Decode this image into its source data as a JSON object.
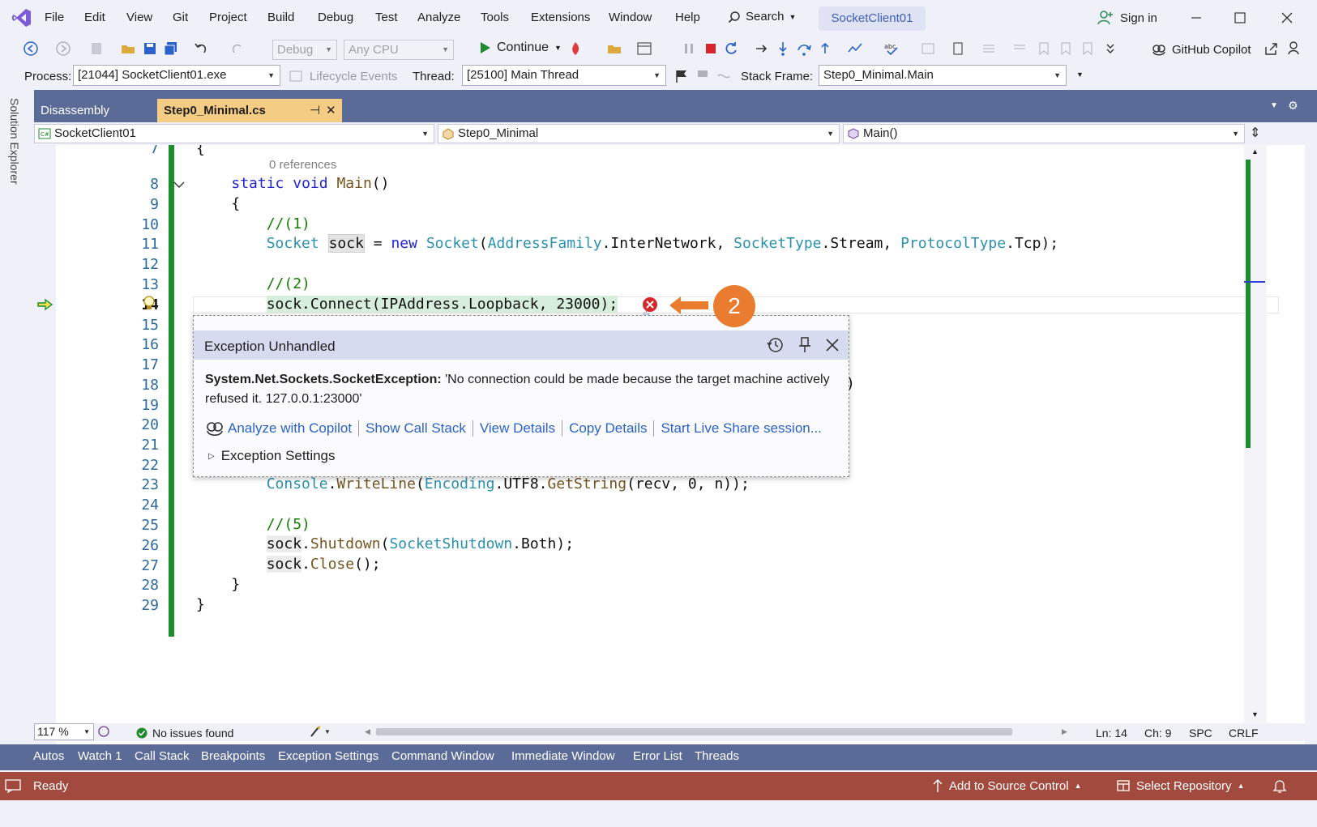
{
  "menu": {
    "items": [
      "File",
      "Edit",
      "View",
      "Git",
      "Project",
      "Build",
      "Debug",
      "Test",
      "Analyze",
      "Tools",
      "Extensions",
      "Window",
      "Help"
    ],
    "search_label": "Search",
    "solution_name": "SocketClient01",
    "sign_in": "Sign in"
  },
  "toolbar": {
    "configuration": "Debug",
    "platform": "Any CPU",
    "continue_label": "Continue",
    "copilot_label": "GitHub Copilot"
  },
  "debug_location": {
    "process_label": "Process:",
    "process_value": "[21044] SocketClient01.exe",
    "lifecycle_label": "Lifecycle Events",
    "thread_label": "Thread:",
    "thread_value": "[25100] Main Thread",
    "stack_frame_label": "Stack Frame:",
    "stack_frame_value": "Step0_Minimal.Main"
  },
  "left_rail": {
    "label": "Solution Explorer"
  },
  "doc_tabs": [
    {
      "label": "Disassembly"
    },
    {
      "label": "Step0_Minimal.cs"
    }
  ],
  "navbar": {
    "project": "SocketClient01",
    "type": "Step0_Minimal",
    "member": "Main()"
  },
  "editor": {
    "line_numbers": [
      "7",
      "8",
      "9",
      "10",
      "11",
      "12",
      "13",
      "14",
      "15",
      "16",
      "17",
      "18",
      "19",
      "20",
      "21",
      "22",
      "23",
      "24",
      "25",
      "26",
      "27",
      "28",
      "29"
    ],
    "current_line": "14",
    "references_label": "0 references",
    "visible_fragment_line18": ")"
  },
  "exception": {
    "title": "Exception Unhandled",
    "type": "System.Net.Sockets.SocketException:",
    "message": " 'No connection could be made because the target machine actively refused it. 127.0.0.1:23000'",
    "links": [
      "Analyze with Copilot",
      "Show Call Stack",
      "View Details",
      "Copy Details",
      "Start Live Share session..."
    ],
    "settings_label": "Exception Settings"
  },
  "callout": {
    "number": "2",
    "color": "#ea7c2f"
  },
  "editor_status": {
    "zoom": "117 %",
    "issues": "No issues found",
    "line": "Ln: 14",
    "column": "Ch: 9",
    "whitespace": "SPC",
    "line_ending": "CRLF"
  },
  "tool_tabs": [
    "Autos",
    "Watch 1",
    "Call Stack",
    "Breakpoints",
    "Exception Settings",
    "Command Window",
    "Immediate Window",
    "Error List",
    "Threads"
  ],
  "status_bar": {
    "state": "Ready",
    "source_control": "Add to Source Control",
    "repository": "Select Repository",
    "color": "#a24a3e"
  }
}
